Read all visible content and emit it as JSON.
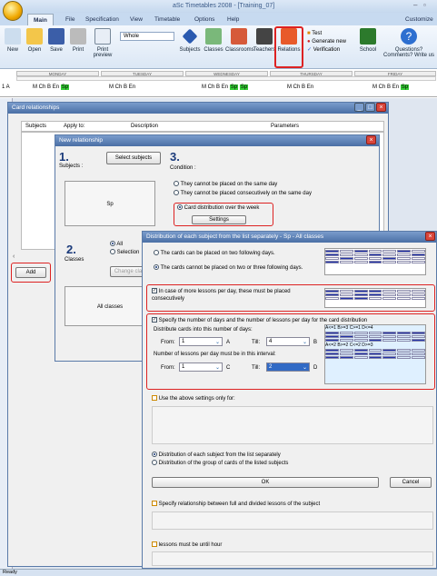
{
  "app": {
    "title": "aSc Timetables 2008 - [Training_07]",
    "customize": "Customize"
  },
  "tabs": [
    "Main",
    "File",
    "Specification",
    "View",
    "Timetable",
    "Options",
    "Help"
  ],
  "ribbon": {
    "new": "New",
    "open": "Open",
    "save": "Save",
    "print": "Print",
    "print_preview": "Print preview",
    "combo": "Whole",
    "subjects": "Subjects",
    "classes": "Classes",
    "classrooms": "Classrooms",
    "teachers": "Teachers",
    "relations": "Relations",
    "test": "Test",
    "generate": "Generate new",
    "verification": "Verification",
    "school": "School",
    "questions": "Questions?",
    "comments": "Comments? Write us"
  },
  "schedule": {
    "days": [
      "MONDAY",
      "TUESDAY",
      "WEDNESDAY",
      "THURSDAY",
      "FRIDAY"
    ],
    "class": "1 A",
    "lessons": [
      [
        "M",
        "Ch",
        "B",
        "En",
        "Sp"
      ],
      [
        "M",
        "Ch",
        "B",
        "En"
      ],
      [
        "M",
        "Ch",
        "B",
        "En",
        "Sp",
        "Sp"
      ],
      [
        "M",
        "Ch",
        "B",
        "En"
      ],
      [
        "M",
        "Ch",
        "B",
        "En",
        "Sp"
      ]
    ]
  },
  "card_rel": {
    "title": "Card relationships",
    "cols": [
      "Subjects",
      "Apply to:",
      "Description",
      "Parameters"
    ],
    "add": "Add"
  },
  "new_rel": {
    "title": "New relationship",
    "step1": "1.",
    "subjects_label": "Subjects :",
    "select_btn": "Select subjects",
    "sp": "Sp",
    "step3": "3.",
    "condition": "Condition :",
    "opt1": "They cannot be placed on the same day",
    "opt2": "They cannot be placed consecutively on the same day",
    "opt3": "Card distribution over the week",
    "settings": "Settings",
    "step2": "2.",
    "classes": "Classes",
    "all": "All",
    "selection": "Selection",
    "change": "Change cla",
    "all_classes": "All classes"
  },
  "dist": {
    "title": "Distribution of each subject from the list separately - Sp - All classes",
    "r1": "The cards can be placed on two following days.",
    "r2": "The cards cannot be placed on two or three following days.",
    "c1": "In case of more lessons per day, these must be placed consecutively",
    "c2": "Specify the number of days and the number of lessons per day for the card distribution",
    "dlabel": "Distribute cards into this number of days:",
    "from": "From:",
    "till": "Till:",
    "from_v1": "1",
    "a": "A",
    "till_v1": "4",
    "b": "B",
    "nlabel": "Number of lessons per day must be in this interval:",
    "from_v2": "1",
    "c": "C",
    "till_v2": "2",
    "d": "D",
    "legend1": "A<=1  B>=3  C>=1  D<=4",
    "legend2": "A<=2  B>=2  C<=2  D>=3",
    "use_above": "Use the above settings only for:",
    "d1": "Distribution of each subject from the list separately",
    "d2": "Distribution of the group of cards of the listed subjects",
    "ok": "OK",
    "cancel": "Cancel",
    "full_divided": "Specify relationship between full and divided lessons of the subject",
    "until": "lessons must be until hour"
  },
  "status": "Ready",
  "colors": {
    "accent": "#4a6fa5",
    "highlight": "#d22222",
    "sp": "#33cc33"
  }
}
